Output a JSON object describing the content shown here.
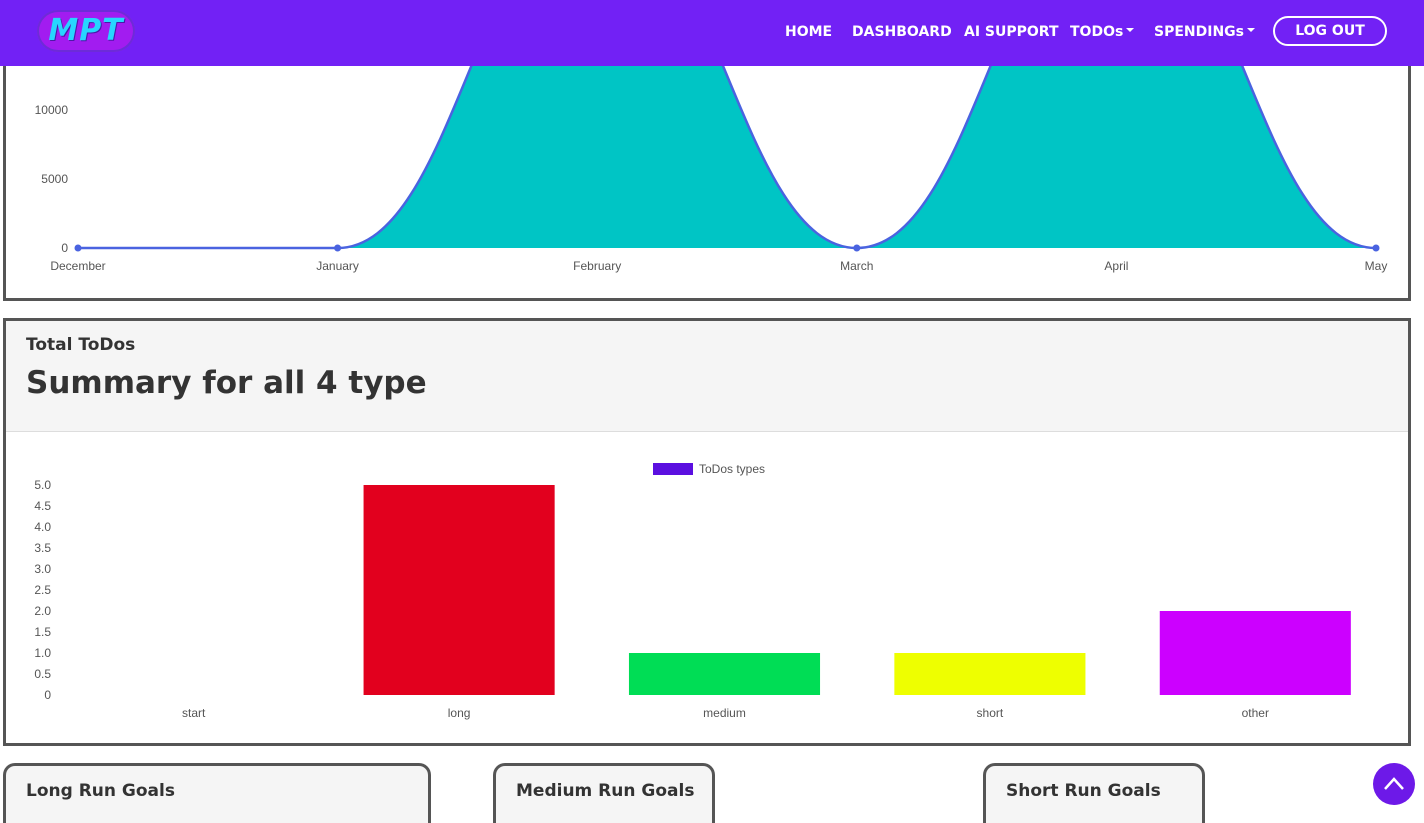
{
  "navbar": {
    "logo_text": "MPT",
    "items": [
      {
        "label": "HOME"
      },
      {
        "label": "DASHBOARD"
      },
      {
        "label": "AI SUPPORT"
      },
      {
        "label": "TODOs"
      },
      {
        "label": "SPENDINGs"
      }
    ],
    "logout_label": "LOG OUT"
  },
  "area_chart": {
    "chart_data": {
      "type": "area",
      "categories": [
        "December",
        "January",
        "February",
        "March",
        "April",
        "May"
      ],
      "values": [
        0,
        0,
        25000,
        0,
        25000,
        0
      ],
      "y_ticks": [
        "0",
        "5000",
        "10000"
      ],
      "ylim": [
        0,
        28000
      ],
      "colors": {
        "fill": "#00c5c5",
        "line": "#4a63e0"
      }
    }
  },
  "todos_panel": {
    "subtitle": "Total ToDos",
    "title": "Summary for all 4 type",
    "chart_data": {
      "type": "bar",
      "legend": "ToDos types",
      "legend_color": "#5b0fe0",
      "categories": [
        "start",
        "long",
        "medium",
        "short",
        "other"
      ],
      "values": [
        0,
        5,
        1,
        1,
        2
      ],
      "colors": [
        "#4ac0c0",
        "#e2001e",
        "#00dd55",
        "#eeff00",
        "#cc00ff"
      ],
      "y_ticks": [
        "0",
        "0.5",
        "1.0",
        "1.5",
        "2.0",
        "2.5",
        "3.0",
        "3.5",
        "4.0",
        "4.5",
        "5.0"
      ],
      "ylim": [
        0,
        5
      ]
    }
  },
  "goals": [
    {
      "label": "Long Run Goals"
    },
    {
      "label": "Medium Run Goals"
    },
    {
      "label": "Short Run Goals"
    }
  ]
}
